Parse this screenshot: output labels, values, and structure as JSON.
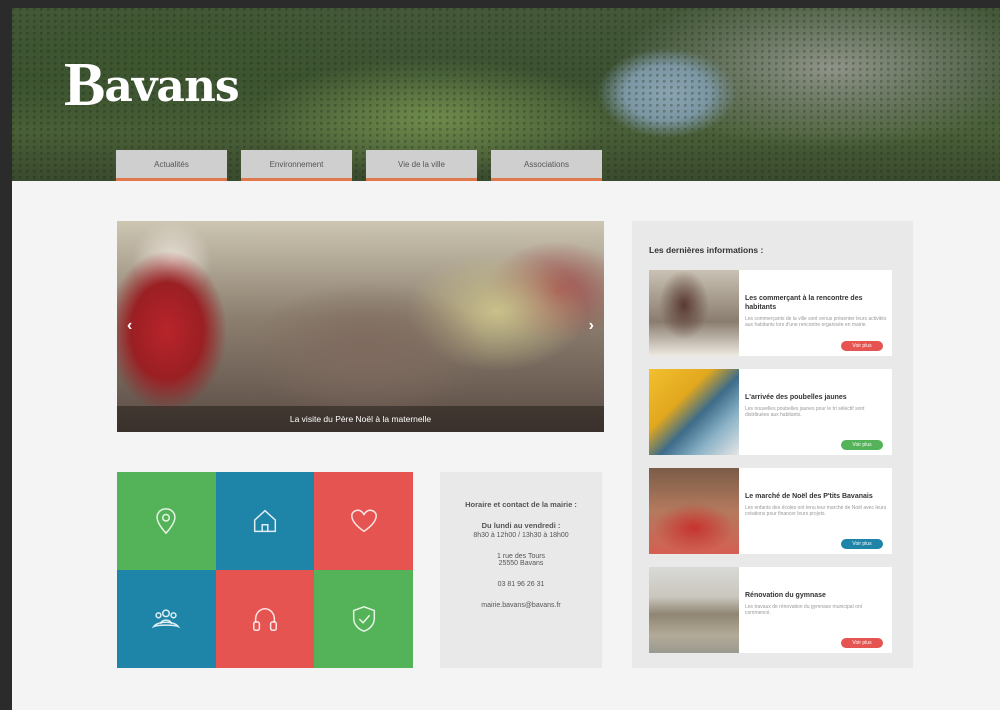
{
  "site": {
    "logo_text": "Bavans"
  },
  "nav": {
    "tabs": [
      {
        "label": "Actualités"
      },
      {
        "label": "Environnement"
      },
      {
        "label": "Vie de la ville"
      },
      {
        "label": "Associations"
      }
    ]
  },
  "slider": {
    "caption": "La visite du Père Noël à la maternelle",
    "prev_icon": "chevron-left-icon",
    "next_icon": "chevron-right-icon"
  },
  "tiles": [
    {
      "icon": "map-pin-icon",
      "color": "#54b358"
    },
    {
      "icon": "home-icon",
      "color": "#1e84a8"
    },
    {
      "icon": "heart-icon",
      "color": "#e55450"
    },
    {
      "icon": "community-icon",
      "color": "#1e84a8"
    },
    {
      "icon": "headphones-icon",
      "color": "#e55450"
    },
    {
      "icon": "shield-check-icon",
      "color": "#54b358"
    }
  ],
  "contact": {
    "title": "Horaire et contact de la mairie :",
    "days": "Du lundi au vendredi :",
    "hours": "8h30 à 12h00 / 13h30 à 18h00",
    "address_line1": "1 rue des Tours",
    "address_line2": "25550 Bavans",
    "phone": "03 81 96 26 31",
    "email": "mairie.bavans@bavans.fr"
  },
  "news": {
    "title": "Les dernières informations :",
    "items": [
      {
        "headline": "Les commerçant à la rencontre des habitants",
        "excerpt": "Les commerçants de la ville sont venus présenter leurs activités aux habitants lors d'une rencontre organisée en mairie.",
        "button": "Voir plus",
        "button_color": "#e55450"
      },
      {
        "headline": "L'arrivée des poubelles jaunes",
        "excerpt": "Les nouvelles poubelles jaunes pour le tri sélectif sont distribuées aux habitants.",
        "button": "Voir plus",
        "button_color": "#54b358"
      },
      {
        "headline": "Le marché de Noël des P'tits Bavanais",
        "excerpt": "Les enfants des écoles ont tenu leur marché de Noël avec leurs créations pour financer leurs projets.",
        "button": "Voir plus",
        "button_color": "#1e84a8"
      },
      {
        "headline": "Rénovation du gymnase",
        "excerpt": "Les travaux de rénovation du gymnase municipal ont commencé.",
        "button": "Voir plus",
        "button_color": "#e55450"
      }
    ]
  }
}
